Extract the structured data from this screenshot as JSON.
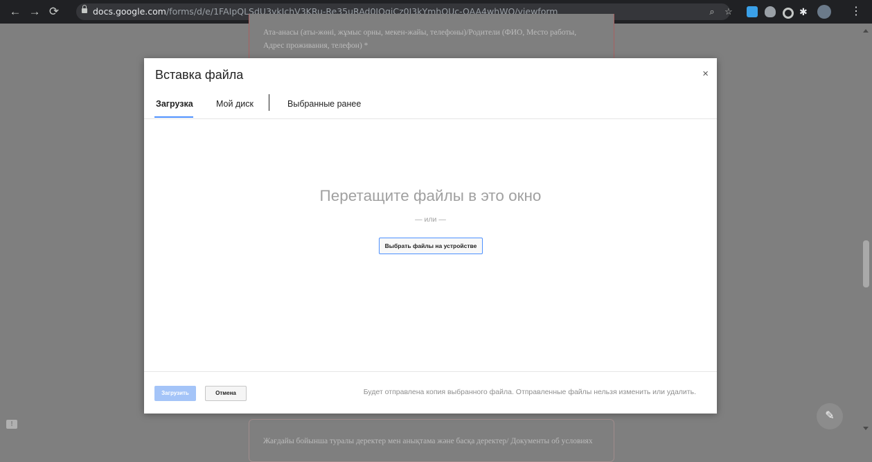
{
  "browser": {
    "url_host": "docs.google.com",
    "url_path": "/forms/d/e/1FAIpQLSdU3ykIchV3KRu-Re35uRAd0JOqiCz0I3kYmhQUc-OAA4whWQ/viewform",
    "icons": [
      "back-arrow-icon",
      "forward-arrow-icon",
      "reload-icon",
      "lock-icon",
      "zoom-icon",
      "star-icon",
      "extension-icons",
      "avatar",
      "menu-icon"
    ]
  },
  "page": {
    "question_text": "Ата-анасы (аты-жөні, жұмыс орны, мекен-жайы, телефоны)/Родители (ФИО, Место работы, Адрес проживания, телефон) *",
    "next_question_text": "Жағдайы бойынша туралы деректер мен анықтама және басқа деректер/ Документы об условиях"
  },
  "dialog": {
    "title": "Вставка файла",
    "close_label": "×",
    "tabs": [
      {
        "label": "Загрузка",
        "active": true
      },
      {
        "label": "Мой диск",
        "active": false
      },
      {
        "label": "Выбранные ранее",
        "active": false
      }
    ],
    "drop_title": "Перетащите файлы в это окно",
    "drop_or": "— или —",
    "select_button": "Выбрать файлы на устройстве",
    "upload_button": "Загрузить",
    "cancel_button": "Отмена",
    "footer_note": "Будет отправлена копия выбранного файла. Отправленные файлы нельзя изменить или удалить."
  },
  "colors": {
    "browser_bar": "#202124",
    "overlay": "#7f7f7f",
    "accent": "#4d90fe",
    "upload_disabled": "#a4c4f8"
  }
}
